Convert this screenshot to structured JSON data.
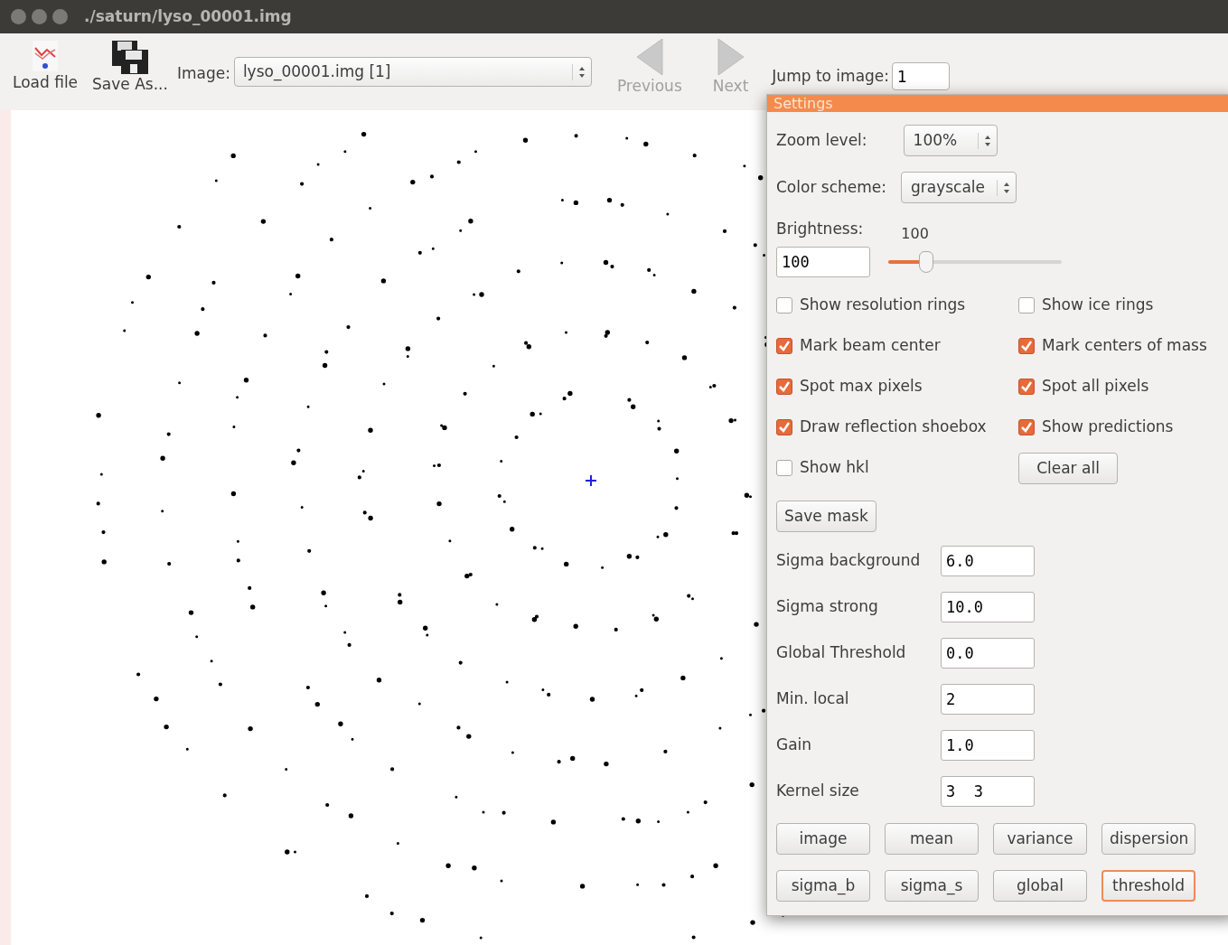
{
  "window": {
    "title": "./saturn/lyso_00001.img"
  },
  "toolbar": {
    "load_file": "Load file",
    "save_as": "Save As...",
    "image_label": "Image:",
    "image_select": "lyso_00001.img [1]",
    "previous": {
      "label": "Previous",
      "disabled": true
    },
    "next": {
      "label": "Next",
      "disabled": true
    },
    "jump_label": "Jump to image:",
    "jump_value": "1"
  },
  "settings": {
    "title": "Settings",
    "zoom": {
      "label": "Zoom level:",
      "value": "100%"
    },
    "color_scheme": {
      "label": "Color scheme:",
      "value": "grayscale"
    },
    "brightness": {
      "label": "Brightness:",
      "reading": "100",
      "value": "100",
      "level": 0.22
    },
    "checkboxes": [
      {
        "label": "Show resolution rings",
        "checked": false
      },
      {
        "label": "Show ice rings",
        "checked": false
      },
      {
        "label": "Mark beam center",
        "checked": true
      },
      {
        "label": "Mark centers of mass",
        "checked": true
      },
      {
        "label": "Spot max pixels",
        "checked": true
      },
      {
        "label": "Spot all pixels",
        "checked": true
      },
      {
        "label": "Draw reflection shoebox",
        "checked": true
      },
      {
        "label": "Show predictions",
        "checked": true
      },
      {
        "label": "Show hkl",
        "checked": false
      }
    ],
    "clear_all": "Clear all",
    "save_mask": "Save mask",
    "params": [
      {
        "label": "Sigma background",
        "value": "6.0"
      },
      {
        "label": "Sigma strong",
        "value": "10.0"
      },
      {
        "label": "Global Threshold",
        "value": "0.0"
      },
      {
        "label": "Min. local",
        "value": "2"
      },
      {
        "label": "Gain",
        "value": "1.0"
      },
      {
        "label": "Kernel size",
        "value": "3  3"
      }
    ],
    "view_buttons": [
      {
        "label": "image",
        "selected": false
      },
      {
        "label": "mean",
        "selected": false
      },
      {
        "label": "variance",
        "selected": false
      },
      {
        "label": "dispersion",
        "selected": false
      },
      {
        "label": "sigma_b",
        "selected": false
      },
      {
        "label": "sigma_s",
        "selected": false
      },
      {
        "label": "global",
        "selected": false
      },
      {
        "label": "threshold",
        "selected": true
      }
    ]
  }
}
